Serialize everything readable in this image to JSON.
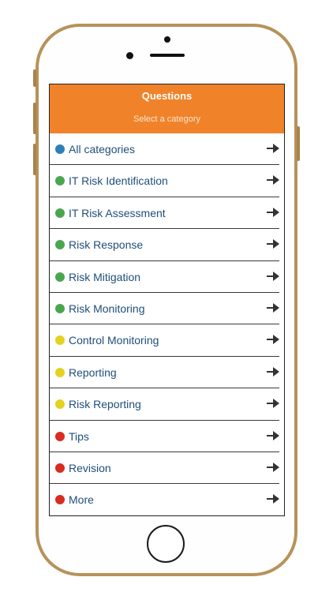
{
  "header": {
    "title": "Questions",
    "subtitle": "Select a category",
    "color": "#f0832a"
  },
  "categories": [
    {
      "label": "All categories",
      "dot_color": "#2f7fb6"
    },
    {
      "label": "IT Risk Identification",
      "dot_color": "#4aa64e"
    },
    {
      "label": "IT Risk Assessment",
      "dot_color": "#4aa64e"
    },
    {
      "label": "Risk Response",
      "dot_color": "#4aa64e"
    },
    {
      "label": "Risk Mitigation",
      "dot_color": "#4aa64e"
    },
    {
      "label": "Risk Monitoring",
      "dot_color": "#4aa64e"
    },
    {
      "label": "Control Monitoring",
      "dot_color": "#e3d21e"
    },
    {
      "label": "Reporting",
      "dot_color": "#e3d21e"
    },
    {
      "label": "Risk Reporting",
      "dot_color": "#e3d21e"
    },
    {
      "label": "Tips",
      "dot_color": "#d92b1f"
    },
    {
      "label": "Revision",
      "dot_color": "#d92b1f"
    },
    {
      "label": "More",
      "dot_color": "#d92b1f"
    }
  ],
  "row_icon": "right-arrow-icon"
}
